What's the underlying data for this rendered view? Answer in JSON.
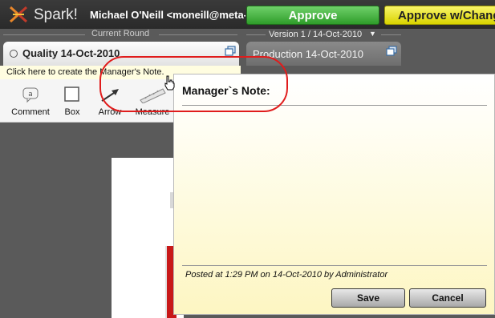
{
  "app": {
    "name": "Spark!"
  },
  "header": {
    "user": "Michael O'Neill <moneill@meta-co",
    "approve_label": "Approve",
    "approve_changes_label": "Approve w/Changes"
  },
  "rounds": {
    "current_label": "Current Round",
    "version_label": "Version 1 / 14-Oct-2010"
  },
  "tabs": [
    {
      "label": "Quality 14-Oct-2010",
      "icon": "popout-icon"
    },
    {
      "label": "Production 14-Oct-2010",
      "icon": "popout-icon"
    }
  ],
  "tooltip": {
    "text": "Click here to create the Manager's Note."
  },
  "toolbar": {
    "tools": [
      {
        "label": "Comment",
        "icon": "comment-icon"
      },
      {
        "label": "Box",
        "icon": "box-icon"
      },
      {
        "label": "Arrow",
        "icon": "arrow-icon"
      },
      {
        "label": "Measure",
        "icon": "ruler-icon"
      }
    ]
  },
  "note": {
    "title": "Manager`s Note:",
    "posted": "Posted at 1:29 PM on 14-Oct-2010 by Administrator",
    "save_label": "Save",
    "cancel_label": "Cancel"
  },
  "colors": {
    "approve": "#3fae3a",
    "approve_changes": "#f2ec1f",
    "annotation": "#e01c1c",
    "note_bg": "#fdf6c2"
  }
}
